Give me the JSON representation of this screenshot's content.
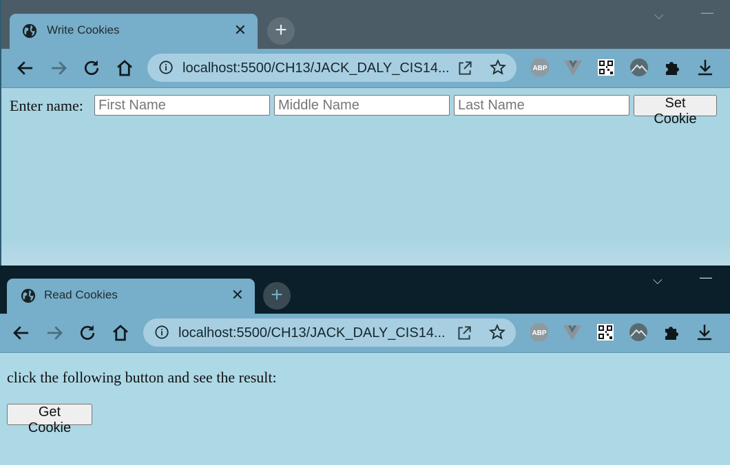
{
  "top_window": {
    "tab": {
      "title": "Write Cookies"
    },
    "address": {
      "url": "localhost:5500/CH13/JACK_DALY_CIS14..."
    },
    "form": {
      "label": "Enter name:",
      "first_placeholder": "First Name",
      "middle_placeholder": "Middle Name",
      "last_placeholder": "Last Name",
      "button": "Set Cookie"
    }
  },
  "bottom_window": {
    "tab": {
      "title": "Read Cookies"
    },
    "address": {
      "url": "localhost:5500/CH13/JACK_DALY_CIS14..."
    },
    "body": {
      "instruction": "click the following button and see the result:",
      "button": "Get Cookie"
    }
  },
  "extensions": [
    {
      "icon": "adblock-plus-icon",
      "label": "ABP"
    },
    {
      "icon": "vue-devtools-icon"
    },
    {
      "icon": "qr-code-icon"
    },
    {
      "icon": "mountain-icon"
    },
    {
      "icon": "puzzle-icon"
    },
    {
      "icon": "download-icon"
    }
  ],
  "colors": {
    "page_bg": "#add8e6",
    "toolbar": "#77aec9",
    "tab_active": "#77aec9"
  }
}
